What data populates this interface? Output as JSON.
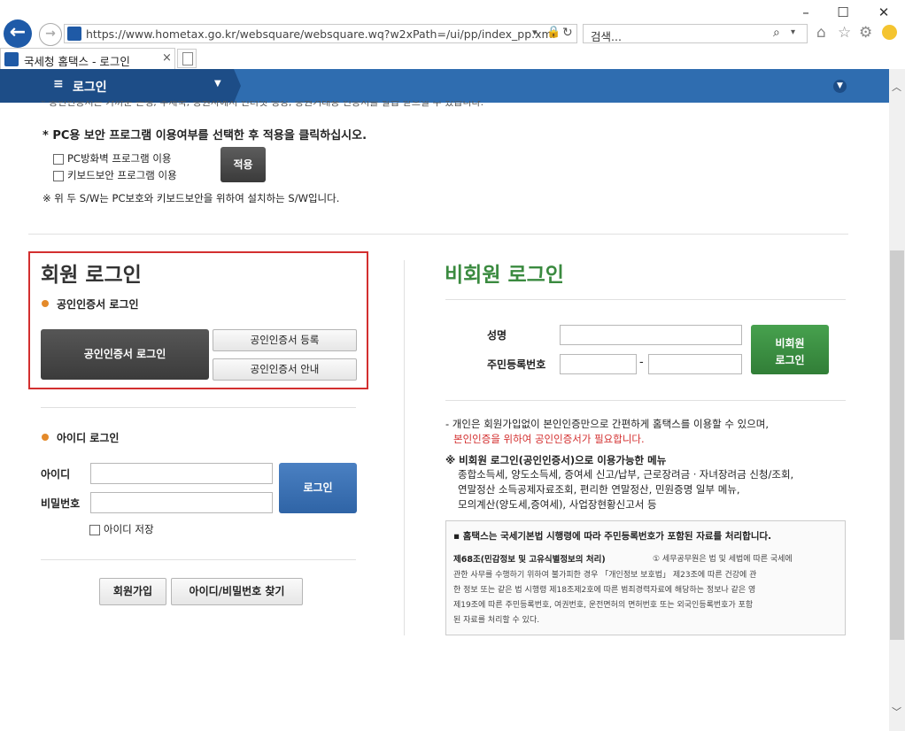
{
  "browser": {
    "url": "https://www.hometax.go.kr/websquare/websquare.wq?w2xPath=/ui/pp/index_pp.xml",
    "search_placeholder": "검색...",
    "tab_title": "국세청 홈택스 - 로그인",
    "tab_close": "×",
    "window_controls": {
      "minimize": "–",
      "maximize": "☐",
      "close": "✕"
    }
  },
  "topnav": {
    "menu_label": "로그인"
  },
  "security": {
    "cut_notice": "* 공인인증서는 가까운 은행, 우체국, 증권사에서 인터넷 뱅킹, 증권거래용 인증서를 발급 받으실 수 있습니다.",
    "instruction": "* PC용 보안 프로그램 이용여부를 선택한 후 적용을 클릭하십시오.",
    "firewall_label": "PC방화벽 프로그램 이용",
    "keyboard_label": "키보드보안 프로그램 이용",
    "apply_label": "적용",
    "note": "※ 위 두 S/W는 PC보호와 키보드보안을 위하여 설치하는 S/W입니다."
  },
  "member": {
    "title": "회원 로그인",
    "cert_section": "공인인증서 로그인",
    "cert_login_btn": "공인인증서 로그인",
    "cert_register_btn": "공인인증서 등록",
    "cert_guide_btn": "공인인증서 안내",
    "id_section": "아이디 로그인",
    "id_label": "아이디",
    "pw_label": "비밀번호",
    "login_btn": "로그인",
    "save_id_label": "아이디 저장",
    "signup_btn": "회원가입",
    "find_btn": "아이디/비밀번호 찾기"
  },
  "guest": {
    "title": "비회원 로그인",
    "name_label": "성명",
    "rrn_label": "주민등록번호",
    "rrn_dash": "-",
    "login_btn_line1": "비회원",
    "login_btn_line2": "로그인",
    "desc_line1": "- 개인은 회원가입없이 본인인증만으로 간편하게 홈택스를 이용할 수 있으며,",
    "desc_line2": "본인인증을 위하여 공인인증서가 필요합니다.",
    "menu_title": "※ 비회원 로그인(공인인증서)으로 이용가능한 메뉴",
    "menu_line1": "종합소득세, 양도소득세, 증여세 신고/납부, 근로장려금ㆍ자녀장려금 신청/조회,",
    "menu_line2": "연말정산 소득공제자료조회, 편리한 연말정산, 민원증명 일부 메뉴,",
    "menu_line3": "모의계산(양도세,증여세), 사업장현황신고서 등",
    "legal_title": "▪ 홈택스는 국세기본법 시행령에 따라 주민등록번호가 포함된 자료를 처리합니다.",
    "legal_bold": "제68조(민감정보 및 고유식별정보의 처리)",
    "legal_line1": "① 세무공무원은 법 및 세법에 따른 국세에",
    "legal_line2": "관한 사무를 수행하기 위하여 불가피한 경우 「개인정보 보호법」 제23조에 따른 건강에 관",
    "legal_line3": "한 정보 또는 같은 법 시행령 제18조제2호에 따른 범죄경력자료에 해당하는 정보나 같은 영",
    "legal_line4": "제19조에 따른 주민등록번호, 여권번호, 운전면허의 면허번호 또는 외국인등록번호가 포함",
    "legal_line5": "된 자료를 처리할 수 있다."
  },
  "colors": {
    "nav_blue": "#2f6db0",
    "highlight_red": "#d32f2f",
    "guest_green": "#3a8a3f",
    "login_blue": "#3a6fb0"
  }
}
